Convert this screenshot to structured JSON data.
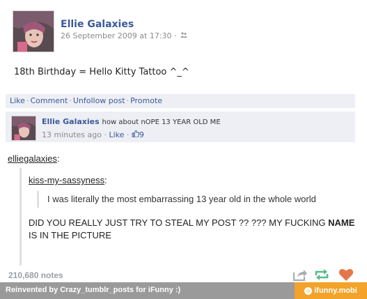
{
  "post": {
    "author": "Ellie Galaxies",
    "timestamp": "26 September 2009 at 17:30",
    "meta_sep": "·",
    "status": "18th Birthday = Hello Kitty Tattoo ^_^",
    "actions": [
      "Like",
      "Comment",
      "Unfollow post",
      "Promote"
    ],
    "icons": {
      "audience": "people-icon",
      "avatar": "profile-photo"
    }
  },
  "comment": {
    "author": "Ellie Galaxies",
    "text": "how about nOPE 13 YEAR OLD ME",
    "time": "13 minutes ago",
    "like_label": "Like",
    "like_count": "9",
    "sep": "·"
  },
  "tumblr": {
    "user1": "elliegalaxies",
    "user2": "kiss-my-sassyness",
    "colon": ":",
    "quote": "I was literally the most embarrassing 13 year old in the whole world",
    "reply_before": "DID YOU REALLY JUST TRY TO STEAL MY POST ?? ??? MY FUCKING",
    "reply_bold": "NAME",
    "reply_after": "IS IN THE PICTURE",
    "notes": "210,680 notes",
    "icons": {
      "share": "share-icon",
      "reblog": "reblog-icon",
      "like": "heart-icon"
    },
    "colors": {
      "reblog": "#56bc8a",
      "heart": "#e5764c"
    }
  },
  "footer": {
    "credit": "Reinvented by Crazy_tumblr_posts for iFunny :)",
    "brand": "ifunny.mobi",
    "colors": {
      "bar": "#9a9a9a",
      "brand": "#f3a32a"
    }
  }
}
